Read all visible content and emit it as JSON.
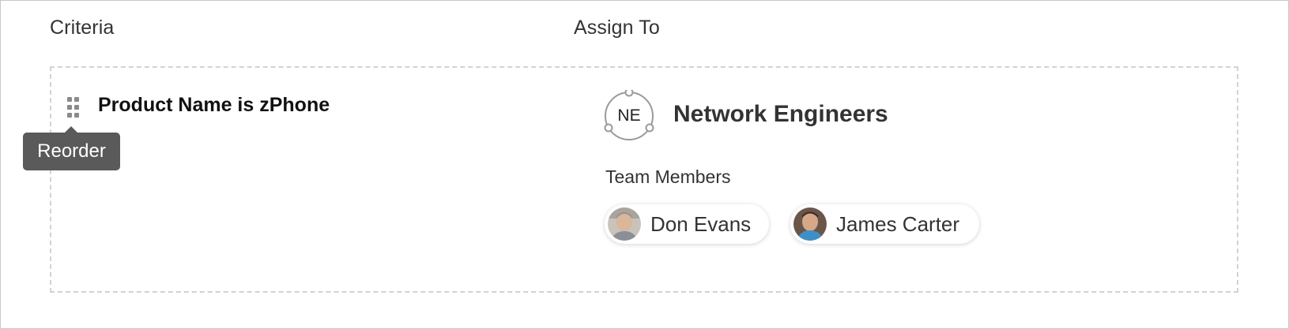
{
  "headers": {
    "criteria": "Criteria",
    "assign_to": "Assign To"
  },
  "rule": {
    "criteria_text": "Product Name is zPhone",
    "tooltip": "Reorder",
    "drag_icon": "drag-handle-icon"
  },
  "assignment": {
    "team_initials": "NE",
    "team_name": "Network Engineers",
    "members_label": "Team Members",
    "members": [
      {
        "name": "Don Evans",
        "avatar": "avatar-photo"
      },
      {
        "name": "James Carter",
        "avatar": "avatar-photo"
      }
    ]
  },
  "colors": {
    "tooltip_bg": "#5a5a5a",
    "dashed_border": "#d2d2d2",
    "text": "#333333"
  }
}
